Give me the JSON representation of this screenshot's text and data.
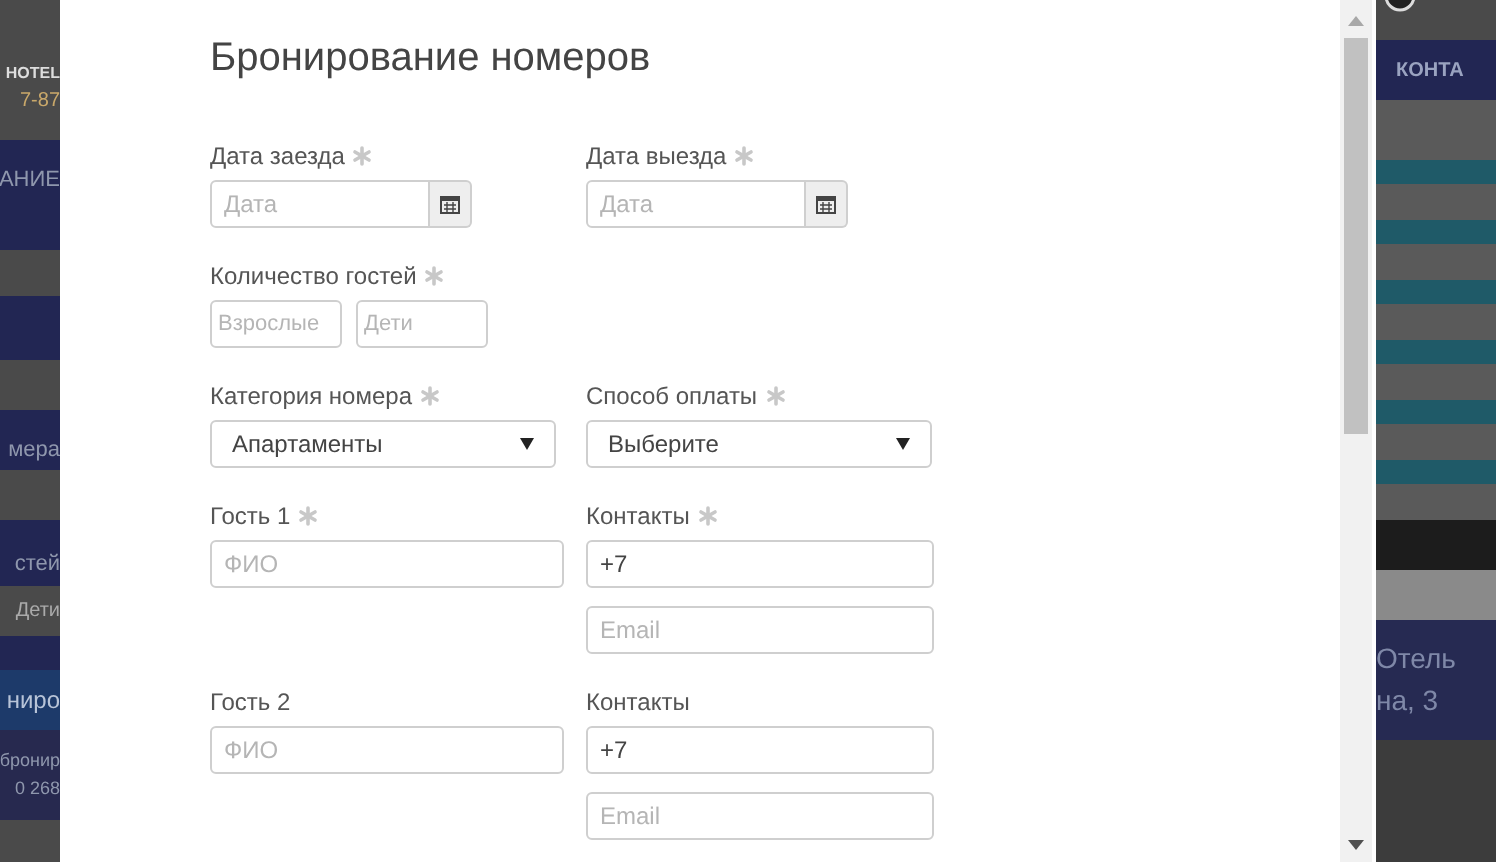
{
  "backdrop": {
    "left_texts": [
      "HOTEL",
      "7-87",
      "АНИЕ",
      "мера",
      "стей",
      "Дети",
      "ниро",
      "бронир",
      "0 268"
    ],
    "right_texts": [
      "КОНТА",
      "Отель",
      "на, 3"
    ]
  },
  "modal": {
    "title": "Бронирование номеров",
    "rows": [
      {
        "fields": [
          {
            "kind": "date",
            "label": "Дата заезда",
            "required": true,
            "placeholder": "Дата"
          },
          {
            "kind": "date",
            "label": "Дата выезда",
            "required": true,
            "placeholder": "Дата"
          }
        ]
      },
      {
        "fields": [
          {
            "kind": "pair",
            "label": "Количество гостей",
            "required": true,
            "inputs": [
              {
                "placeholder": "Взрослые"
              },
              {
                "placeholder": "Дети"
              }
            ]
          }
        ]
      },
      {
        "fields": [
          {
            "kind": "select",
            "label": "Категория номера",
            "required": true,
            "value": "Апартаменты"
          },
          {
            "kind": "select",
            "label": "Способ оплаты",
            "required": true,
            "value": "Выберите"
          }
        ]
      },
      {
        "fields": [
          {
            "kind": "text",
            "label": "Гость 1",
            "required": true,
            "placeholder": "ФИО"
          },
          {
            "kind": "contacts",
            "label": "Контакты",
            "required": true,
            "inputs": [
              {
                "value": "+7"
              },
              {
                "placeholder": "Email"
              }
            ]
          }
        ]
      },
      {
        "fields": [
          {
            "kind": "text",
            "label": "Гость 2",
            "required": false,
            "placeholder": "ФИО"
          },
          {
            "kind": "contacts",
            "label": "Контакты",
            "required": false,
            "inputs": [
              {
                "value": "+7"
              },
              {
                "placeholder": "Email"
              }
            ]
          }
        ]
      }
    ]
  }
}
